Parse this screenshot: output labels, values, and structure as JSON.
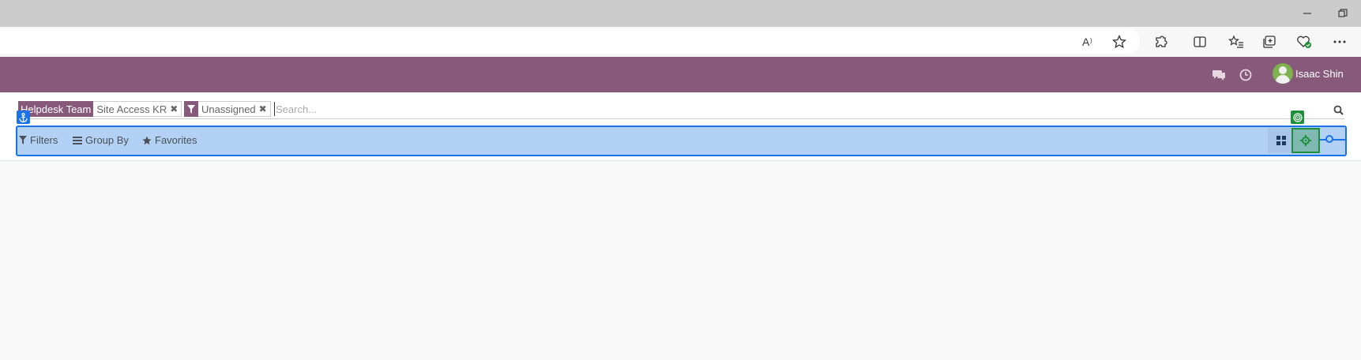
{
  "user": {
    "name": "Isaac Shin"
  },
  "search": {
    "placeholder": "Search...",
    "facets": [
      {
        "label": "Helpdesk Team",
        "value": "Site Access KR"
      },
      {
        "label": "filter-icon",
        "value": "Unassigned"
      }
    ]
  },
  "filters": {
    "filters_label": "Filters",
    "group_by_label": "Group By",
    "favorites_label": "Favorites"
  },
  "colors": {
    "brand": "#875a7b",
    "highlight": "#b3d1f5",
    "accent_blue": "#1a73e8",
    "accent_green": "#1e8f3a"
  }
}
